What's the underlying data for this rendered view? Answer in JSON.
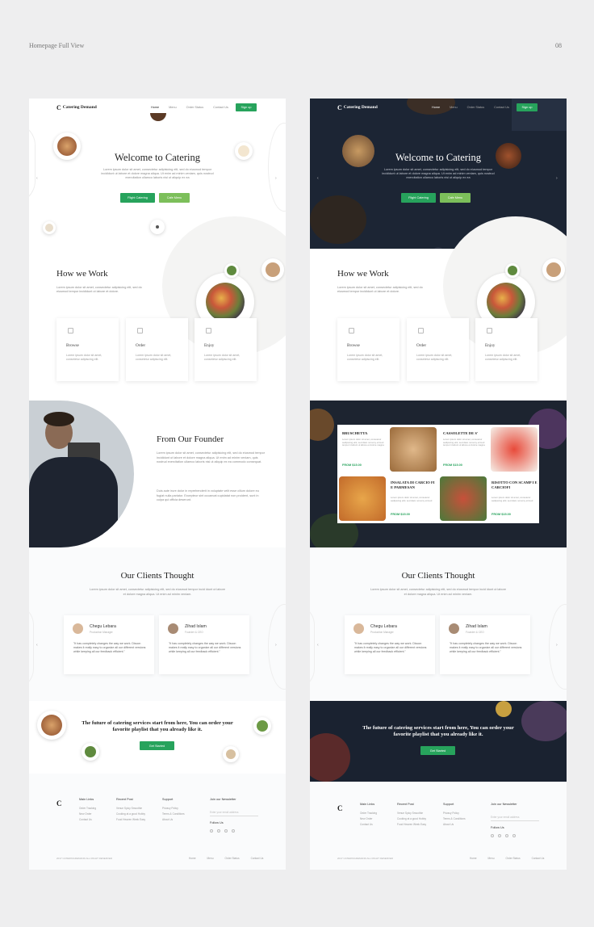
{
  "header": {
    "title": "Homepage Full View",
    "page_number": "08"
  },
  "nav": {
    "logo": "Catering Demand",
    "links": [
      "Home",
      "Menu",
      "Order Status",
      "Contact Us"
    ],
    "signup": "Sign up"
  },
  "hero": {
    "title": "Welcome to Catering",
    "text": "Lorem ipsum dolor sit amet, consectetur adipisicing elit, sed do eiusmod tempor incididunt ut labore et dolore magna aliqua. Ut enim ad minim veniam, quis nostrud exercitation ullamco laboris nisi ut aliquip ex ea",
    "btn_primary": "Flight Catering",
    "btn_secondary": "Cafe Menu"
  },
  "how": {
    "title": "How we Work",
    "text": "Lorem ipsum dolor sit amet, consectetur adipisicing elit, sed do eiusmod tempor incididunt ut labore et dolore.",
    "cards": [
      {
        "title": "Browse",
        "text": "Lorem ipsum dolor sit amet, consetetur adipiscing elit."
      },
      {
        "title": "Order",
        "text": "Lorem ipsum dolor sit amet, consetetur adipiscing elit."
      },
      {
        "title": "Enjoy",
        "text": "Lorem ipsum dolor sit amet, consetetur adipiscing elit."
      }
    ]
  },
  "founder": {
    "title": "From Our Founder",
    "p1": "Lorem ipsum dolor sit amet, consectetur adipisicing elit, sed do eiusmod tempor incididunt ut labore et dolore magna aliqua. Ut enim ad minim veniam, quis nostrud exercitation ullamco laboris nisi ut aliquip ex ea commodo consequat.",
    "p2": "Duis aute irure dolor in reprehenderit in voluptate velit esse cillum dolore eu fugiat nulla pariatur. Excepteur sint occaecat cupidatat non proident, sunt in culpa qui officia deserunt."
  },
  "menu": {
    "items": [
      {
        "name": "BRUSCHETTA",
        "text": "Lorem ipsum dolor sit amet, consetetur sadipscing elitr, sed diam nonumy eirmod tempor invidunt ut labore et dolore magna",
        "price": "FROM $15.00"
      },
      {
        "name": "CASSOLETTE DE S'",
        "text": "Lorem ipsum dolor sit amet, consetetur sadipscing elitr, sed diam nonumy eirmod tempor invidunt ut labore et dolore magna",
        "price": "FROM $15.00"
      },
      {
        "name": "INSALATA DI CARCIO FI E PARMESAN",
        "text": "Lorem ipsum dolor sit amet, consetetur sadipscing elitr, sed diam nonumy eirmod",
        "price": "FROM $15.00"
      },
      {
        "name": "RISOTTO CON SCAMP I E CARCIOFI",
        "text": "Lorem ipsum dolor sit amet, consetetur sadipscing elitr, sed diam nonumy eirmod",
        "price": "FROM $15.00"
      }
    ]
  },
  "clients": {
    "title": "Our Clients Thought",
    "text": "Lorem ipsum dolor sit amet, consectetur adipisicing elit, sed do eiusmod tempor incid idunt ut labore et dolore magna aliqua. Ut enim ad minim veniam.",
    "testimonials": [
      {
        "name": "Chegu Lebara",
        "role": "Production Manager",
        "quote": "\"It has completely changes the way we work. Discon makes it really easy to organize all our different versions while keeping all our feedback efficient.\""
      },
      {
        "name": "Zihad Islam",
        "role": "Founder & CEO",
        "quote": "\"It has completely changes the way we work. Discon makes it really easy to organize all our different versions while keeping all our feedback efficient.\""
      }
    ]
  },
  "cta": {
    "text": "The future of catering services start from here, You can order your favorite playlist that you already like it.",
    "button": "Get Started"
  },
  "footer": {
    "cols": [
      {
        "title": "Main Links",
        "links": [
          "Order Tracking",
          "New Order",
          "Contact Us"
        ]
      },
      {
        "title": "Recent Post",
        "links": [
          "Venue Spicy Smoothie",
          "Cooking at a good Hobby",
          "Food Heaven Week Easy"
        ]
      },
      {
        "title": "Support",
        "links": [
          "Privacy Policy",
          "Terms & Conditions",
          "About Us"
        ]
      }
    ],
    "newsletter_title": "Join our Newsletter",
    "newsletter_placeholder": "Enter your email address",
    "follow": "Follow Us",
    "copyright": "2017 CATERINGDEMAND ALL RIGHT RESERVED",
    "links": [
      "Home",
      "Menu",
      "Order Status",
      "Contact Us"
    ]
  },
  "colors": {
    "accent": "#27a35c",
    "accent_light": "#7cbf5a",
    "dark_bg": "#1c2534"
  }
}
